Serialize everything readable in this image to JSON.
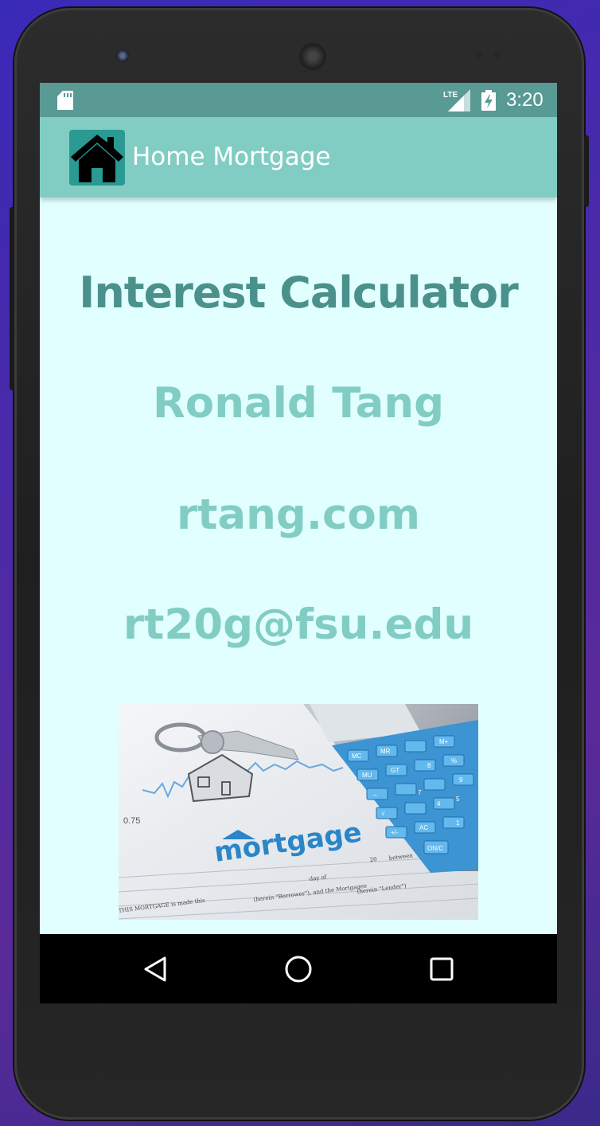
{
  "status_bar": {
    "time": "3:20",
    "network": "LTE",
    "icons": [
      "sd-card-icon",
      "signal-icon",
      "battery-charging-icon"
    ]
  },
  "app_bar": {
    "title": "Home Mortgage",
    "logo_icon": "house-icon"
  },
  "content": {
    "heading": "Interest Calculator",
    "name": "Ronald Tang",
    "website": "rtang.com",
    "email": "rt20g@fsu.edu",
    "image": {
      "description_icon": "mortgage-photo",
      "printed_text": "mortgage",
      "calculator_keys": [
        "MC",
        "MR",
        "M+",
        "%",
        "MU",
        "GT",
        "8",
        "9",
        "7",
        "4",
        "5",
        "1",
        "AC",
        "ON/C",
        "+/-",
        "√",
        "→"
      ],
      "document_text": [
        "THIS MORTGAGE is made this",
        "day of",
        "20",
        "between",
        "(herein \"Borrower\"), and the Mortgagee",
        "(herein \"Lender\")",
        "0.75"
      ]
    }
  },
  "nav_bar": {
    "buttons": [
      "back-icon",
      "home-icon",
      "recents-icon"
    ]
  },
  "colors": {
    "status_bar": "#5a9a95",
    "app_bar": "#81cdc4",
    "background": "#e2ffff",
    "heading": "#4b918b",
    "text_light": "#81cdc4"
  }
}
